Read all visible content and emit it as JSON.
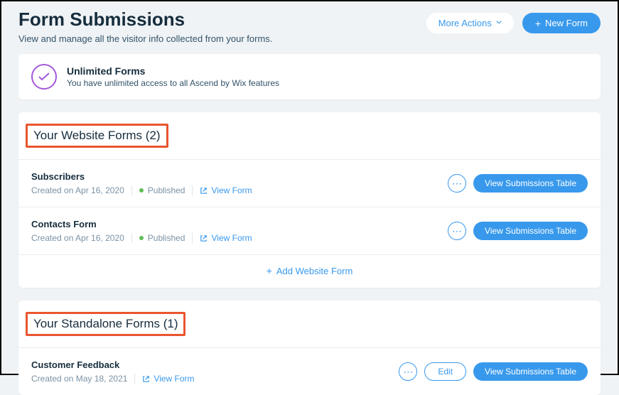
{
  "header": {
    "title": "Form Submissions",
    "subtitle": "View and manage all the visitor info collected from your forms.",
    "moreActions": "More Actions",
    "newForm": "New Form"
  },
  "banner": {
    "title": "Unlimited Forms",
    "subtitle": "You have unlimited access to all Ascend by Wix features"
  },
  "websiteSection": {
    "title": "Your Website Forms (2)",
    "addLabel": "Add Website Form",
    "forms": [
      {
        "name": "Subscribers",
        "created": "Created on Apr 16, 2020",
        "status": "Published",
        "viewForm": "View Form",
        "viewTable": "View Submissions Table"
      },
      {
        "name": "Contacts Form",
        "created": "Created on Apr 16, 2020",
        "status": "Published",
        "viewForm": "View Form",
        "viewTable": "View Submissions Table"
      }
    ]
  },
  "standaloneSection": {
    "title": "Your Standalone Forms (1)",
    "forms": [
      {
        "name": "Customer Feedback",
        "created": "Created on May 18, 2021",
        "viewForm": "View Form",
        "edit": "Edit",
        "viewTable": "View Submissions Table"
      }
    ]
  }
}
